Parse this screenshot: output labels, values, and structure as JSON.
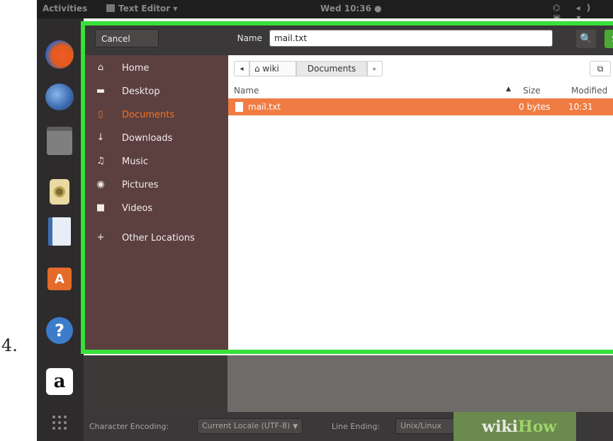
{
  "step_number": "4.",
  "topbar": {
    "activities": "Activities",
    "app_name": "Text Editor ▾",
    "clock": "Wed 10:36 ●",
    "tray": "⌬ ◂) ▣ ▾"
  },
  "dock": {
    "help_glyph": "?",
    "amazon_glyph": "a",
    "software_glyph": "A"
  },
  "dialog": {
    "cancel_label": "Cancel",
    "name_label": "Name",
    "filename_value": "mail.txt",
    "search_glyph": "🔍",
    "save_label": "Save",
    "sidebar": [
      {
        "icon": "home-icon",
        "glyph": "⌂",
        "label": "Home"
      },
      {
        "icon": "folder-icon",
        "glyph": "▬",
        "label": "Desktop"
      },
      {
        "icon": "document-icon",
        "glyph": "▯",
        "label": "Documents",
        "active": true
      },
      {
        "icon": "download-icon",
        "glyph": "↓",
        "label": "Downloads"
      },
      {
        "icon": "music-icon",
        "glyph": "♫",
        "label": "Music"
      },
      {
        "icon": "camera-icon",
        "glyph": "◉",
        "label": "Pictures"
      },
      {
        "icon": "video-icon",
        "glyph": "■",
        "label": "Videos"
      },
      {
        "icon": "plus-icon",
        "glyph": "+",
        "label": "Other Locations"
      }
    ],
    "pathbar": {
      "back": "◂",
      "home_crumb": "⌂ wiki",
      "current_crumb": "Documents",
      "forward": "▸",
      "new_folder": "⧉"
    },
    "columns": {
      "name": "Name",
      "sort_glyph": "▲",
      "size": "Size",
      "modified": "Modified"
    },
    "files": [
      {
        "name": "mail.txt",
        "size": "0 bytes",
        "modified": "10:31"
      }
    ]
  },
  "statusbar": {
    "encoding_label": "Character Encoding:",
    "encoding_value": "Current Locale (UTF-8)",
    "line_ending_label": "Line Ending:",
    "line_ending_value": "Unix/Linux"
  },
  "watermark": {
    "wiki": "wiki",
    "how": "How"
  },
  "colors": {
    "highlight": "#38e03a",
    "accent": "#f47421",
    "save": "#49a934",
    "selection": "#f07c43",
    "sidebar": "#5c4040"
  }
}
